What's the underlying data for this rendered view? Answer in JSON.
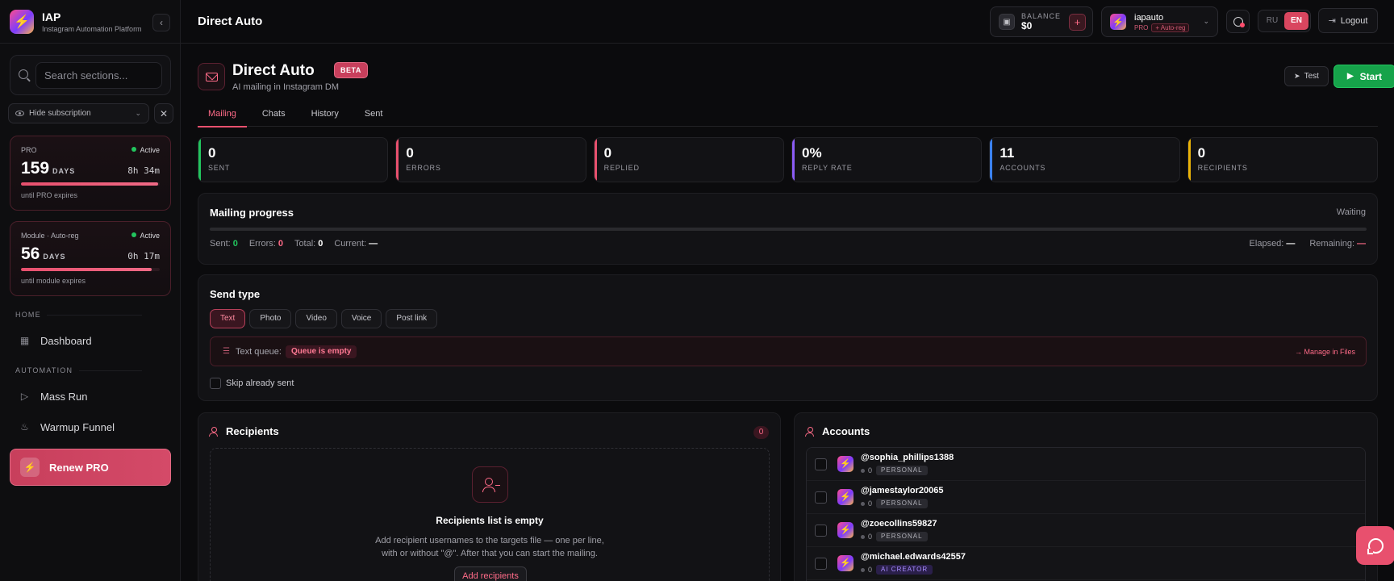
{
  "brand": {
    "title": "IAP",
    "subtitle": "Instagram Automation Platform",
    "logo_icon": "bolt-icon"
  },
  "sidebar": {
    "search_placeholder": "Search sections...",
    "hide_subscription": "Hide subscription",
    "subscriptions": [
      {
        "label": "PRO",
        "status": "Active",
        "days": "159",
        "days_unit": "DAYS",
        "timer": "8h 34m",
        "note": "until PRO expires",
        "progress": 0.99
      },
      {
        "label": "Module · Auto-reg",
        "status": "Active",
        "days": "56",
        "days_unit": "DAYS",
        "timer": "0h 17m",
        "note": "until module expires",
        "progress": 0.94
      }
    ],
    "sections": [
      {
        "title": "HOME",
        "items": [
          {
            "label": "Dashboard",
            "icon": "grid-icon"
          }
        ]
      },
      {
        "title": "AUTOMATION",
        "items": [
          {
            "label": "Mass Run",
            "icon": "play-icon"
          },
          {
            "label": "Warmup Funnel",
            "icon": "flame-icon"
          }
        ]
      }
    ],
    "renew_label": "Renew PRO"
  },
  "topbar": {
    "page_title": "Direct Auto",
    "balance_label": "BALANCE",
    "balance_value": "$0",
    "account_name": "iapauto",
    "account_plan": "PRO",
    "account_tag": "+ Auto-reg",
    "langs": [
      "RU",
      "EN"
    ],
    "active_lang": "EN",
    "logout_label": "Logout"
  },
  "header": {
    "title": "Direct Auto",
    "badge": "BETA",
    "subtitle": "AI mailing in Instagram DM",
    "test_label": "Test",
    "start_label": "Start"
  },
  "tabs": [
    "Mailing",
    "Chats",
    "History",
    "Sent"
  ],
  "active_tab": "Mailing",
  "stats": [
    {
      "value": "0",
      "label": "SENT",
      "color": "#22c55e"
    },
    {
      "value": "0",
      "label": "ERRORS",
      "color": "#e8506e"
    },
    {
      "value": "0",
      "label": "REPLIED",
      "color": "#e8506e"
    },
    {
      "value": "0%",
      "label": "REPLY RATE",
      "color": "#8b5cf6"
    },
    {
      "value": "11",
      "label": "ACCOUNTS",
      "color": "#3b82f6"
    },
    {
      "value": "0",
      "label": "RECIPIENTS",
      "color": "#eab308"
    }
  ],
  "progress": {
    "title": "Mailing progress",
    "status": "Waiting",
    "percent": 0,
    "sent_label": "Sent:",
    "sent": "0",
    "errors_label": "Errors:",
    "errors": "0",
    "total_label": "Total:",
    "total": "0",
    "current_label": "Current:",
    "current": "—",
    "elapsed_label": "Elapsed:",
    "elapsed": "—",
    "remaining_label": "Remaining:",
    "remaining": "—"
  },
  "send_type": {
    "title": "Send type",
    "types": [
      "Text",
      "Photo",
      "Video",
      "Voice",
      "Post link"
    ],
    "active": "Text",
    "queue_label": "Text queue:",
    "queue_status": "Queue is empty",
    "manage_link": "→ Manage in Files",
    "skip_label": "Skip already sent"
  },
  "recipients": {
    "title": "Recipients",
    "count": "0",
    "empty_title": "Recipients list is empty",
    "empty_line1": "Add recipient usernames to the targets file — one per line,",
    "empty_line2": "with or without \"@\". After that you can start the mailing.",
    "add_label": "Add recipients"
  },
  "accounts": {
    "title": "Accounts",
    "items": [
      {
        "username": "@sophia_phillips1388",
        "count": "0",
        "tag": "PERSONAL"
      },
      {
        "username": "@jamestaylor20065",
        "count": "0",
        "tag": "PERSONAL"
      },
      {
        "username": "@zoecollins59827",
        "count": "0",
        "tag": "PERSONAL"
      },
      {
        "username": "@michael.edwards42557",
        "count": "0",
        "tag": "AI CREATOR"
      }
    ]
  }
}
